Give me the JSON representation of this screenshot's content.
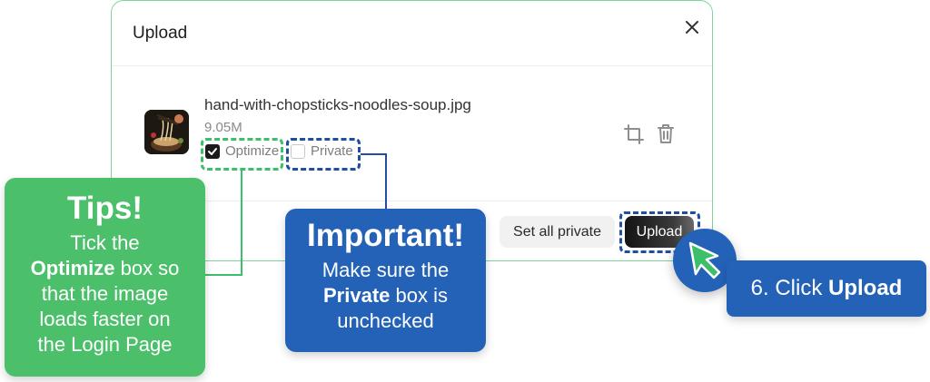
{
  "dialog": {
    "title": "Upload",
    "file": {
      "name": "hand-with-chopsticks-noodles-soup.jpg",
      "size": "9.05M"
    },
    "options": [
      {
        "label": "Optimize",
        "checked": true
      },
      {
        "label": "Private",
        "checked": false
      }
    ],
    "buttons": {
      "set_all_private": "Set all private",
      "upload": "Upload"
    },
    "icons": [
      "close-icon",
      "crop-icon",
      "trash-icon"
    ]
  },
  "annotations": {
    "tips": {
      "heading": "Tips!",
      "line1": "Tick the",
      "line2_bold": "Optimize",
      "line2_rest": " box so",
      "line3": "that the image",
      "line4": "loads faster on",
      "line5": "the Login Page"
    },
    "important": {
      "heading": "Important!",
      "line1": "Make sure the",
      "line2_bold": "Private",
      "line2_rest": " box is",
      "line3": "unchecked"
    },
    "step": {
      "prefix": "6. Click ",
      "bold": "Upload"
    }
  },
  "colors": {
    "green_callout": "#4cbf6b",
    "blue_callout": "#2462b8",
    "pointer_arrow": "#3cbf6a"
  }
}
